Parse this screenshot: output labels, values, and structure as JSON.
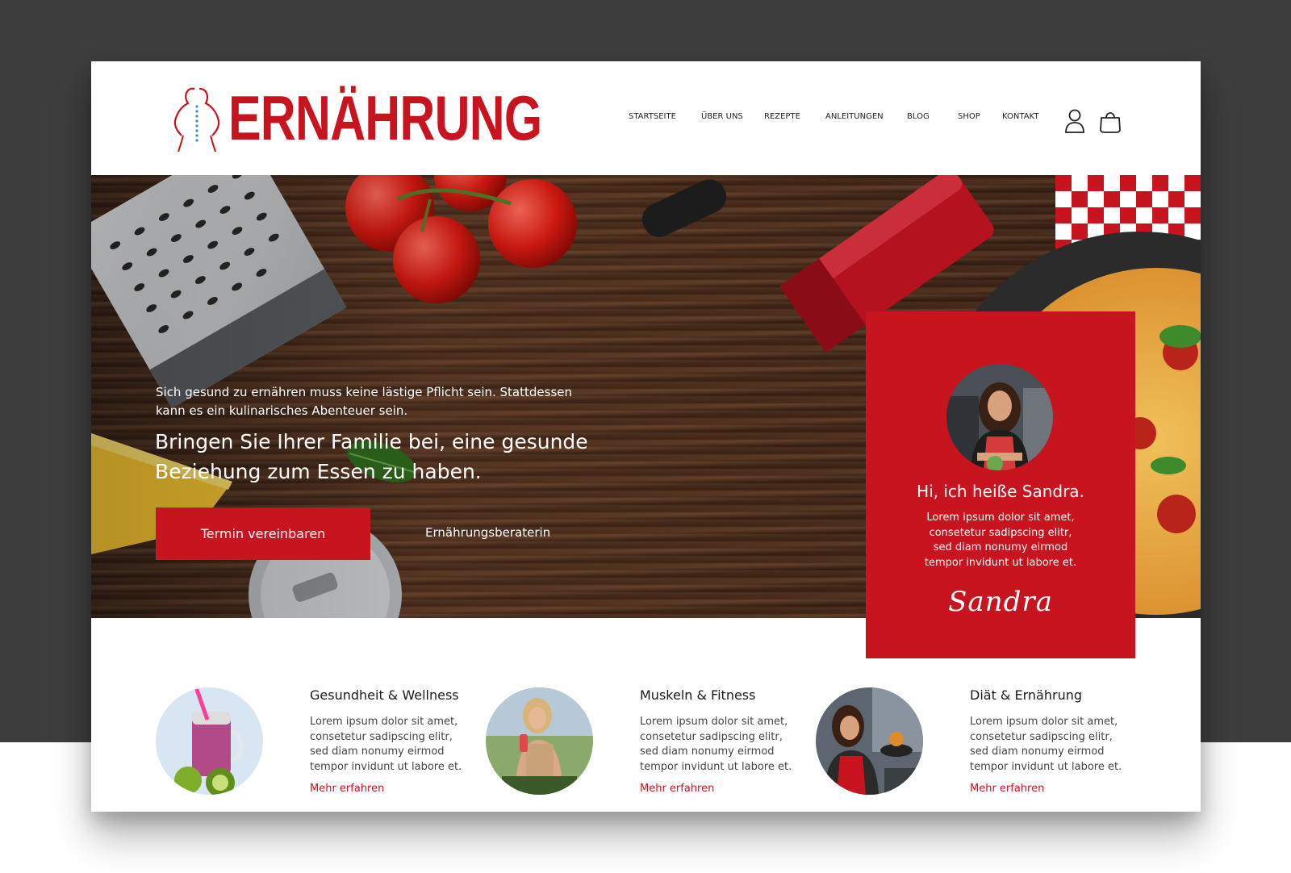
{
  "brand": {
    "name": "ERNÄHRUNG",
    "accent": "#c8141f"
  },
  "nav": {
    "items": [
      "STARTSEITE",
      "ÜBER UNS",
      "REZEPTE",
      "ANLEITUNGEN",
      "BLOG",
      "SHOP",
      "KONTAKT"
    ],
    "icons": [
      "user-icon",
      "shopping-bag-icon"
    ]
  },
  "hero": {
    "subtitle": "Sich gesund zu ernähren muss keine lästige Pflicht sein. Stattdessen kann es ein kulinarisches Abenteuer sein.",
    "title": "Bringen Sie Ihrer Familie bei, eine gesunde Beziehung zum Essen zu haben.",
    "cta_label": "Termin vereinbaren",
    "link_label": "Ernährungsberaterin"
  },
  "profile": {
    "greeting": "Hi, ich heiße Sandra.",
    "text": "Lorem ipsum dolor sit amet,\nconsetetur sadipscing elitr,\nsed diam nonumy eirmod\ntempor invidunt ut labore et.",
    "signature": "Sandra"
  },
  "features": [
    {
      "title": "Gesundheit & Wellness",
      "text": "Lorem ipsum dolor sit amet,\nconsetetur sadipscing elitr,\nsed diam nonumy eirmod\ntempor invidunt ut labore et.",
      "link": "Mehr erfahren"
    },
    {
      "title": "Muskeln & Fitness",
      "text": "Lorem ipsum dolor sit amet,\nconsetetur sadipscing elitr,\nsed diam nonumy eirmod\ntempor invidunt ut labore et.",
      "link": "Mehr erfahren"
    },
    {
      "title": "Diät & Ernährung",
      "text": "Lorem ipsum dolor sit amet,\nconsetetur sadipscing elitr,\nsed diam nonumy eirmod\ntempor invidunt ut labore et.",
      "link": "Mehr erfahren"
    }
  ]
}
